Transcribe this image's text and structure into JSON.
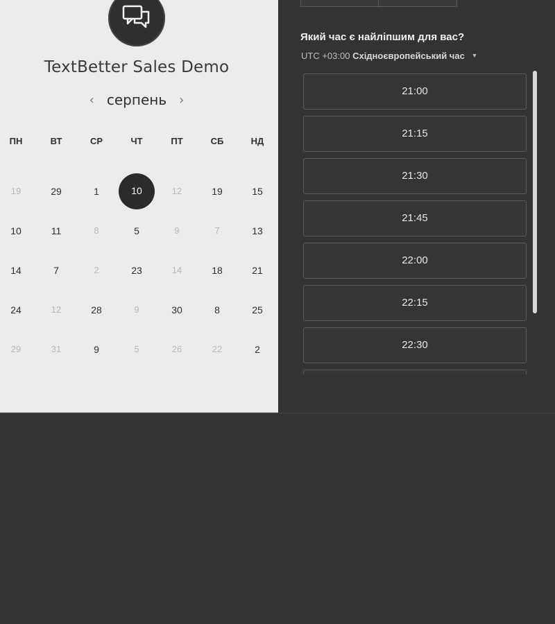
{
  "header": {
    "title": "TextBetter Sales Demo",
    "logo_icon": "chat-bubbles-icon"
  },
  "calendar": {
    "month": "серпень",
    "prev": "‹",
    "next": "›",
    "weekdays": [
      "ПН",
      "ВТ",
      "СР",
      "ЧТ",
      "ПТ",
      "СБ",
      "НД"
    ],
    "weeks": [
      [
        {
          "d": "19",
          "muted": true
        },
        {
          "d": "29",
          "muted": false
        },
        {
          "d": "1",
          "muted": false
        },
        {
          "d": "10",
          "muted": false,
          "selected": true
        },
        {
          "d": "12",
          "muted": true
        },
        {
          "d": "19",
          "muted": false
        },
        {
          "d": "15",
          "muted": false
        }
      ],
      [
        {
          "d": "10",
          "muted": false
        },
        {
          "d": "11",
          "muted": false
        },
        {
          "d": "8",
          "muted": true
        },
        {
          "d": "5",
          "muted": false
        },
        {
          "d": "9",
          "muted": true
        },
        {
          "d": "7",
          "muted": true
        },
        {
          "d": "13",
          "muted": false
        }
      ],
      [
        {
          "d": "14",
          "muted": false
        },
        {
          "d": "7",
          "muted": false
        },
        {
          "d": "2",
          "muted": true
        },
        {
          "d": "23",
          "muted": false
        },
        {
          "d": "14",
          "muted": true
        },
        {
          "d": "18",
          "muted": false
        },
        {
          "d": "21",
          "muted": false
        }
      ],
      [
        {
          "d": "24",
          "muted": false
        },
        {
          "d": "12",
          "muted": true
        },
        {
          "d": "28",
          "muted": false
        },
        {
          "d": "9",
          "muted": true
        },
        {
          "d": "30",
          "muted": false
        },
        {
          "d": "8",
          "muted": false
        },
        {
          "d": "25",
          "muted": false
        }
      ],
      [
        {
          "d": "29",
          "muted": true
        },
        {
          "d": "31",
          "muted": true
        },
        {
          "d": "9",
          "muted": false
        },
        {
          "d": "5",
          "muted": true
        },
        {
          "d": "26",
          "muted": true
        },
        {
          "d": "22",
          "muted": true
        },
        {
          "d": "2",
          "muted": false
        }
      ]
    ]
  },
  "times": {
    "question": "Який час є найліпшим для вас?",
    "tz_offset": "UTC +03:00",
    "tz_name": "Східноєвропейський час",
    "slots": [
      "21:00",
      "21:15",
      "21:30",
      "21:45",
      "22:00",
      "22:15",
      "22:30",
      ""
    ]
  },
  "colors": {
    "dark_bg": "#333333",
    "light_bg": "#ebebeb",
    "selected_day": "#2b2b2b"
  }
}
